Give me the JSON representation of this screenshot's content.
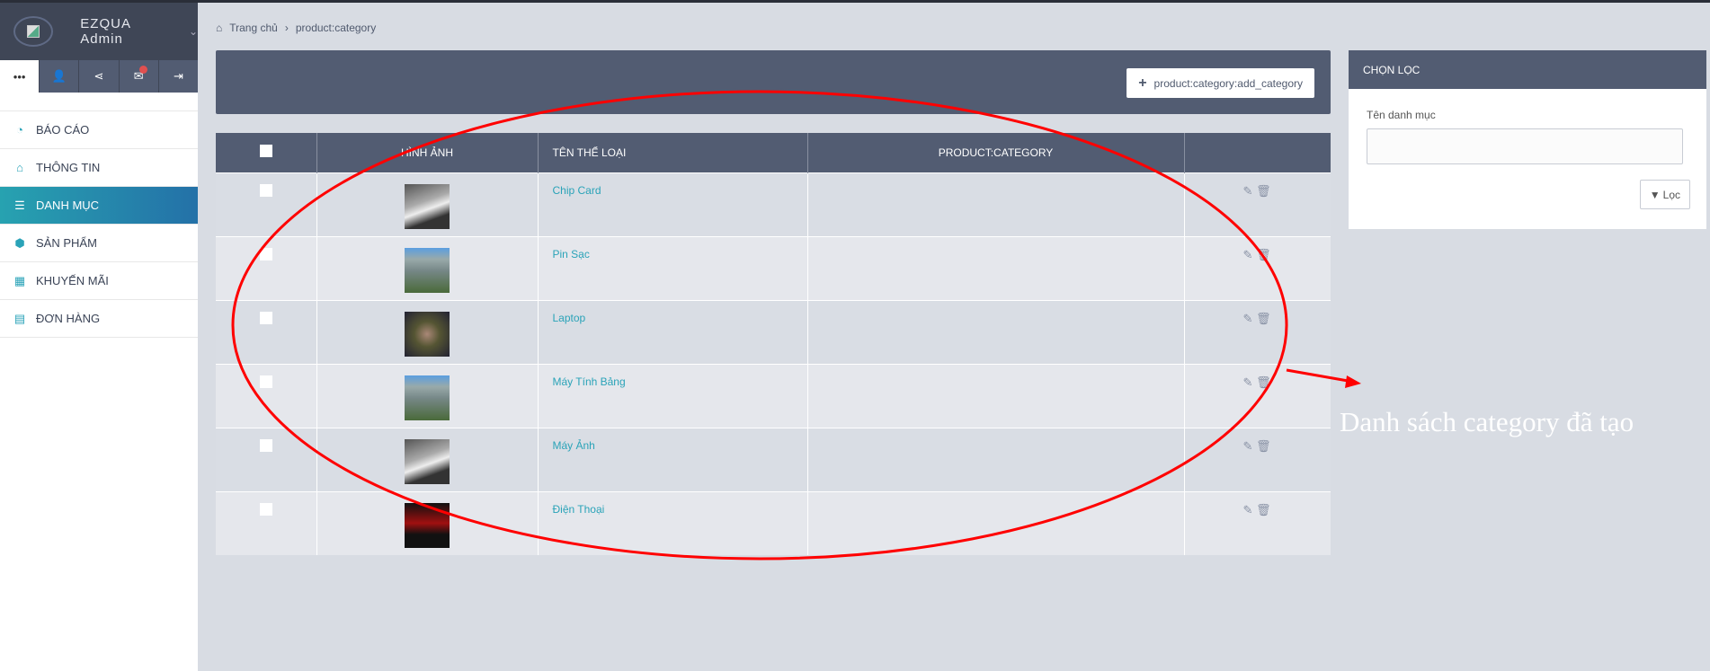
{
  "app": {
    "title": "EZQUA Admin"
  },
  "sidebar": {
    "tabs": [
      {
        "icon": "more-icon",
        "glyph": "•••"
      },
      {
        "icon": "user-icon",
        "glyph": "👤"
      },
      {
        "icon": "share-icon",
        "glyph": "⋖"
      },
      {
        "icon": "mail-icon",
        "glyph": "✉"
      },
      {
        "icon": "logout-icon",
        "glyph": "⇥"
      }
    ],
    "items": [
      {
        "label": "BÁO CÁO",
        "icon": "dashboard-icon",
        "glyph": "◔"
      },
      {
        "label": "THÔNG TIN",
        "icon": "home-icon",
        "glyph": "⌂"
      },
      {
        "label": "DANH MỤC",
        "icon": "list-icon",
        "glyph": "☰",
        "active": true
      },
      {
        "label": "SẢN PHẨM",
        "icon": "cube-icon",
        "glyph": "⬢"
      },
      {
        "label": "KHUYẾN MÃI",
        "icon": "gift-icon",
        "glyph": "▦"
      },
      {
        "label": "ĐƠN HÀNG",
        "icon": "newspaper-icon",
        "glyph": "▤"
      }
    ]
  },
  "breadcrumb": {
    "home": "Trang chủ",
    "sep": "›",
    "current": "product:category"
  },
  "toolbar": {
    "add_label": "product:category:add_category"
  },
  "table": {
    "headers": [
      "HÌNH ẢNH",
      "TÊN THỂ LOẠI",
      "PRODUCT:CATEGORY"
    ],
    "rows": [
      {
        "name": "Chip Card",
        "img": "linear-gradient(160deg,#555 0%,#aaa 40%,#eee 55%,#333 75%)"
      },
      {
        "name": "Pin Sạc",
        "img": "linear-gradient(180deg,#5a9ee0 0%,#9aa 25%,#788 50%,#4a6a3a 100%)"
      },
      {
        "name": "Laptop",
        "img": "radial-gradient(circle,#a87 0%,#553 40%,#223 100%)"
      },
      {
        "name": "Máy Tính Bảng",
        "img": "linear-gradient(180deg,#5a9ee0 0%,#9aa 25%,#788 50%,#4a6a3a 100%)"
      },
      {
        "name": "Máy Ảnh",
        "img": "linear-gradient(160deg,#555 0%,#aaa 40%,#eee 55%,#333 75%)"
      },
      {
        "name": "Điện Thoại",
        "img": "linear-gradient(180deg,#111 0%,#a01010 45%,#111 70%)"
      }
    ]
  },
  "filter": {
    "title": "CHỌN LỌC",
    "field_label": "Tên danh mục",
    "field_value": "",
    "button": "Lọc"
  },
  "annotation": {
    "text": "Danh sách category đã tạo",
    "color": "#ff0000"
  }
}
